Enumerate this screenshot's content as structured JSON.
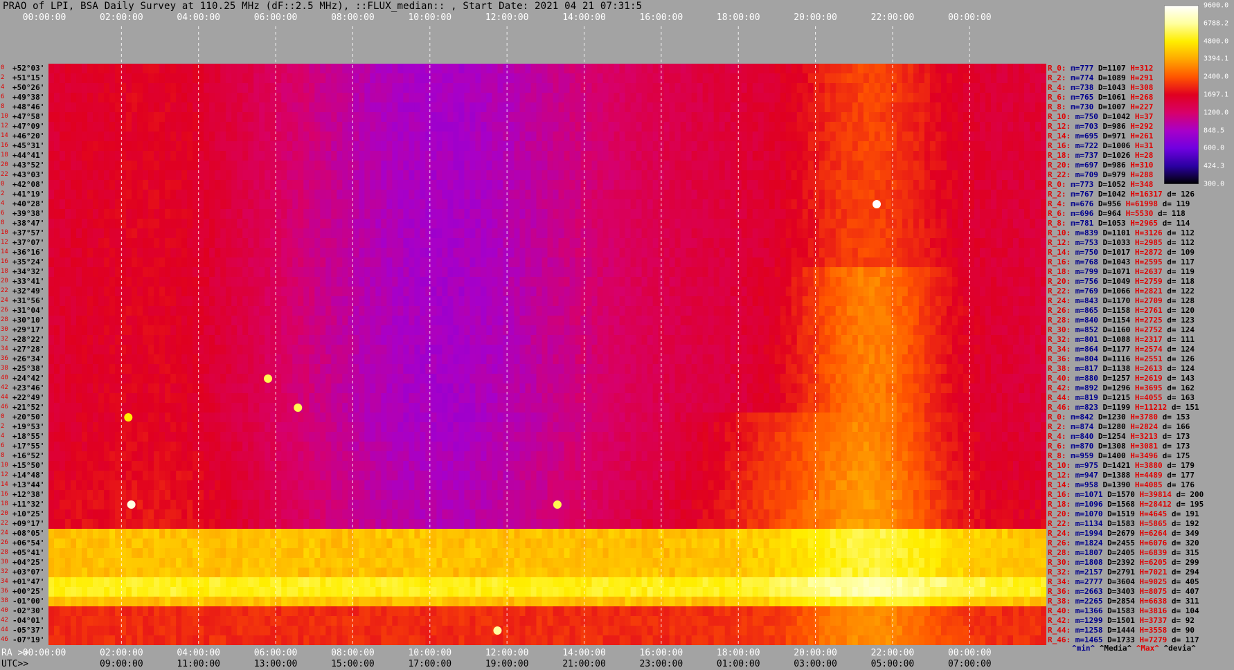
{
  "title": "PRAO of LPI, BSA Daily Survey at 110.25 MHz (dF::2.5 MHz), ::FLUX_median:: , Start Date: 2021 04 21 07:31:5",
  "top_axis_ticks": [
    "00:00:00",
    "02:00:00",
    "04:00:00",
    "06:00:00",
    "08:00:00",
    "10:00:00",
    "12:00:00",
    "14:00:00",
    "16:00:00",
    "18:00:00",
    "20:00:00",
    "22:00:00",
    "00:00:00"
  ],
  "bottom_ra_label": "RA >>",
  "bottom_ra_ticks": [
    "00:00:00",
    "02:00:00",
    "04:00:00",
    "06:00:00",
    "08:00:00",
    "10:00:00",
    "12:00:00",
    "14:00:00",
    "16:00:00",
    "18:00:00",
    "20:00:00",
    "22:00:00",
    "00:00:00"
  ],
  "bottom_utc_label": "UTC>>",
  "bottom_utc_ticks": [
    "09:00:00",
    "11:00:00",
    "13:00:00",
    "15:00:00",
    "17:00:00",
    "19:00:00",
    "21:00:00",
    "23:00:00",
    "01:00:00",
    "03:00:00",
    "05:00:00",
    "07:00:00"
  ],
  "colorbar": {
    "ticks": [
      "9600.0",
      "6788.2",
      "4800.0",
      "3394.1",
      "2400.0",
      "1697.1",
      "1200.0",
      "848.5",
      "600.0",
      "424.3",
      "300.0"
    ],
    "colors": [
      "#ffffff",
      "#ffffa0",
      "#ffee00",
      "#ffa800",
      "#ff5500",
      "#e00020",
      "#d8006a",
      "#a800c8",
      "#7000e0",
      "#2a00a0",
      "#000000"
    ]
  },
  "declinations": [
    "+52°03'",
    "+51°15'",
    "+50°26'",
    "+49°38'",
    "+48°46'",
    "+47°58'",
    "+47°09'",
    "+46°20'",
    "+45°31'",
    "+44°41'",
    "+43°52'",
    "+43°03'",
    "+42°08'",
    "+41°19'",
    "+40°28'",
    "+39°38'",
    "+38°47'",
    "+37°57'",
    "+37°07'",
    "+36°16'",
    "+35°24'",
    "+34°32'",
    "+33°41'",
    "+32°49'",
    "+31°56'",
    "+31°04'",
    "+30°10'",
    "+29°17'",
    "+28°22'",
    "+27°28'",
    "+26°34'",
    "+25°38'",
    "+24°42'",
    "+23°46'",
    "+22°49'",
    "+21°52'",
    "+20°50'",
    "+19°53'",
    "+18°55'",
    "+17°55'",
    "+16°52'",
    "+15°50'",
    "+14°48'",
    "+13°44'",
    "+12°38'",
    "+11°32'",
    "+10°25'",
    "+09°17'",
    "+08°05'",
    "+06°54'",
    "+05°41'",
    "+04°25'",
    "+03°07'",
    "+01°47'",
    "+00°25'",
    "-01°00'",
    "-02°30'",
    "-04°01'",
    "-05°37'",
    "-07°19'"
  ],
  "row_index_labels": [
    "0",
    "2",
    "4",
    "6",
    "8",
    "10",
    "12",
    "14",
    "16",
    "18",
    "20",
    "22",
    "0",
    "2",
    "4",
    "6",
    "8",
    "10",
    "12",
    "14",
    "16",
    "18",
    "20",
    "22",
    "24",
    "26",
    "28",
    "30",
    "32",
    "34",
    "36",
    "38",
    "40",
    "42",
    "44",
    "46",
    "0",
    "2",
    "4",
    "6",
    "8",
    "10",
    "12",
    "14",
    "16",
    "18",
    "20",
    "22",
    "24",
    "26",
    "28",
    "30",
    "32",
    "34",
    "36",
    "38",
    "40",
    "42",
    "44",
    "46"
  ],
  "stats": [
    {
      "r": "R_0:",
      "m": "m=777",
      "d": "D=1107",
      "h": "H=312",
      "dd": ""
    },
    {
      "r": "R_2:",
      "m": "m=774",
      "d": "D=1089",
      "h": "H=291",
      "dd": ""
    },
    {
      "r": "R_4:",
      "m": "m=738",
      "d": "D=1043",
      "h": "H=308",
      "dd": ""
    },
    {
      "r": "R_6:",
      "m": "m=765",
      "d": "D=1061",
      "h": "H=268",
      "dd": ""
    },
    {
      "r": "R_8:",
      "m": "m=730",
      "d": "D=1007",
      "h": "H=227",
      "dd": ""
    },
    {
      "r": "R_10:",
      "m": "m=750",
      "d": "D=1042",
      "h": "H=37",
      "dd": ""
    },
    {
      "r": "R_12:",
      "m": "m=703",
      "d": "D=986",
      "h": "H=292",
      "dd": ""
    },
    {
      "r": "R_14:",
      "m": "m=695",
      "d": "D=971",
      "h": "H=261",
      "dd": ""
    },
    {
      "r": "R_16:",
      "m": "m=722",
      "d": "D=1006",
      "h": "H=31",
      "dd": ""
    },
    {
      "r": "R_18:",
      "m": "m=737",
      "d": "D=1026",
      "h": "H=28",
      "dd": ""
    },
    {
      "r": "R_20:",
      "m": "m=697",
      "d": "D=986",
      "h": "H=310",
      "dd": ""
    },
    {
      "r": "R_22:",
      "m": "m=709",
      "d": "D=979",
      "h": "H=288",
      "dd": ""
    },
    {
      "r": "R_0:",
      "m": "m=773",
      "d": "D=1052",
      "h": "H=348",
      "dd": ""
    },
    {
      "r": "R_2:",
      "m": "m=767",
      "d": "D=1042",
      "h": "H=16317",
      "dd": "d= 126"
    },
    {
      "r": "R_4:",
      "m": "m=676",
      "d": "D=956",
      "h": "H=61998",
      "dd": "d= 119"
    },
    {
      "r": "R_6:",
      "m": "m=696",
      "d": "D=964",
      "h": "H=5530",
      "dd": "d= 118"
    },
    {
      "r": "R_8:",
      "m": "m=781",
      "d": "D=1053",
      "h": "H=2965",
      "dd": "d= 114"
    },
    {
      "r": "R_10:",
      "m": "m=839",
      "d": "D=1101",
      "h": "H=3126",
      "dd": "d= 112"
    },
    {
      "r": "R_12:",
      "m": "m=753",
      "d": "D=1033",
      "h": "H=2985",
      "dd": "d= 112"
    },
    {
      "r": "R_14:",
      "m": "m=750",
      "d": "D=1017",
      "h": "H=2872",
      "dd": "d= 109"
    },
    {
      "r": "R_16:",
      "m": "m=768",
      "d": "D=1043",
      "h": "H=2595",
      "dd": "d= 117"
    },
    {
      "r": "R_18:",
      "m": "m=799",
      "d": "D=1071",
      "h": "H=2637",
      "dd": "d= 119"
    },
    {
      "r": "R_20:",
      "m": "m=756",
      "d": "D=1049",
      "h": "H=2759",
      "dd": "d= 118"
    },
    {
      "r": "R_22:",
      "m": "m=769",
      "d": "D=1066",
      "h": "H=2821",
      "dd": "d= 122"
    },
    {
      "r": "R_24:",
      "m": "m=843",
      "d": "D=1170",
      "h": "H=2709",
      "dd": "d= 128"
    },
    {
      "r": "R_26:",
      "m": "m=865",
      "d": "D=1158",
      "h": "H=2761",
      "dd": "d= 120"
    },
    {
      "r": "R_28:",
      "m": "m=840",
      "d": "D=1154",
      "h": "H=2725",
      "dd": "d= 123"
    },
    {
      "r": "R_30:",
      "m": "m=852",
      "d": "D=1160",
      "h": "H=2752",
      "dd": "d= 124"
    },
    {
      "r": "R_32:",
      "m": "m=801",
      "d": "D=1088",
      "h": "H=2317",
      "dd": "d= 111"
    },
    {
      "r": "R_34:",
      "m": "m=864",
      "d": "D=1177",
      "h": "H=2574",
      "dd": "d= 124"
    },
    {
      "r": "R_36:",
      "m": "m=804",
      "d": "D=1116",
      "h": "H=2551",
      "dd": "d= 126"
    },
    {
      "r": "R_38:",
      "m": "m=817",
      "d": "D=1138",
      "h": "H=2613",
      "dd": "d= 124"
    },
    {
      "r": "R_40:",
      "m": "m=880",
      "d": "D=1257",
      "h": "H=2619",
      "dd": "d= 143"
    },
    {
      "r": "R_42:",
      "m": "m=892",
      "d": "D=1296",
      "h": "H=3695",
      "dd": "d= 162"
    },
    {
      "r": "R_44:",
      "m": "m=819",
      "d": "D=1215",
      "h": "H=4055",
      "dd": "d= 163"
    },
    {
      "r": "R_46:",
      "m": "m=823",
      "d": "D=1199",
      "h": "H=11212",
      "dd": "d= 151"
    },
    {
      "r": "R_0:",
      "m": "m=842",
      "d": "D=1230",
      "h": "H=3780",
      "dd": "d= 153"
    },
    {
      "r": "R_2:",
      "m": "m=874",
      "d": "D=1280",
      "h": "H=2824",
      "dd": "d= 166"
    },
    {
      "r": "R_4:",
      "m": "m=840",
      "d": "D=1254",
      "h": "H=3213",
      "dd": "d= 173"
    },
    {
      "r": "R_6:",
      "m": "m=870",
      "d": "D=1308",
      "h": "H=3081",
      "dd": "d= 173"
    },
    {
      "r": "R_8:",
      "m": "m=959",
      "d": "D=1400",
      "h": "H=3496",
      "dd": "d= 175"
    },
    {
      "r": "R_10:",
      "m": "m=975",
      "d": "D=1421",
      "h": "H=3880",
      "dd": "d= 179"
    },
    {
      "r": "R_12:",
      "m": "m=947",
      "d": "D=1388",
      "h": "H=4489",
      "dd": "d= 177"
    },
    {
      "r": "R_14:",
      "m": "m=958",
      "d": "D=1390",
      "h": "H=4085",
      "dd": "d= 176"
    },
    {
      "r": "R_16:",
      "m": "m=1071",
      "d": "D=1570",
      "h": "H=39814",
      "dd": "d= 200"
    },
    {
      "r": "R_18:",
      "m": "m=1096",
      "d": "D=1568",
      "h": "H=28412",
      "dd": "d= 195"
    },
    {
      "r": "R_20:",
      "m": "m=1070",
      "d": "D=1519",
      "h": "H=4645",
      "dd": "d= 191"
    },
    {
      "r": "R_22:",
      "m": "m=1134",
      "d": "D=1583",
      "h": "H=5865",
      "dd": "d= 192"
    },
    {
      "r": "R_24:",
      "m": "m=1994",
      "d": "D=2679",
      "h": "H=6264",
      "dd": "d= 349"
    },
    {
      "r": "R_26:",
      "m": "m=1824",
      "d": "D=2455",
      "h": "H=6076",
      "dd": "d= 320"
    },
    {
      "r": "R_28:",
      "m": "m=1807",
      "d": "D=2405",
      "h": "H=6839",
      "dd": "d= 315"
    },
    {
      "r": "R_30:",
      "m": "m=1808",
      "d": "D=2392",
      "h": "H=6205",
      "dd": "d= 299"
    },
    {
      "r": "R_32:",
      "m": "m=2157",
      "d": "D=2791",
      "h": "H=7021",
      "dd": "d= 294"
    },
    {
      "r": "R_34:",
      "m": "m=2777",
      "d": "D=3604",
      "h": "H=9025",
      "dd": "d= 405"
    },
    {
      "r": "R_36:",
      "m": "m=2663",
      "d": "D=3403",
      "h": "H=8075",
      "dd": "d= 407"
    },
    {
      "r": "R_38:",
      "m": "m=2265",
      "d": "D=2854",
      "h": "H=6638",
      "dd": "d= 311"
    },
    {
      "r": "R_40:",
      "m": "m=1366",
      "d": "D=1583",
      "h": "H=3816",
      "dd": "d= 104"
    },
    {
      "r": "R_42:",
      "m": "m=1299",
      "d": "D=1501",
      "h": "H=3737",
      "dd": "d= 92"
    },
    {
      "r": "R_44:",
      "m": "m=1258",
      "d": "D=1444",
      "h": "H=3558",
      "dd": "d= 90"
    },
    {
      "r": "R_46:",
      "m": "m=1465",
      "d": "D=1733",
      "h": "H=7279",
      "dd": "d= 117"
    }
  ],
  "stats_footer": {
    "min": "^min^",
    "media": "^Media^",
    "max": "^Max^",
    "devia": "^devia^"
  },
  "chart_data": {
    "type": "heatmap",
    "title": "PRAO of LPI, BSA Daily Survey at 110.25 MHz (dF::2.5 MHz), ::FLUX_median:: , Start Date: 2021 04 21 07:31:5",
    "x_axis": "RA 00:00:00 to 24:00:00 (LST), UTC 07:31 to 07:31",
    "y_categories": "declinations",
    "scale": "log",
    "value_range": [
      300,
      9600
    ],
    "grid": true
  }
}
